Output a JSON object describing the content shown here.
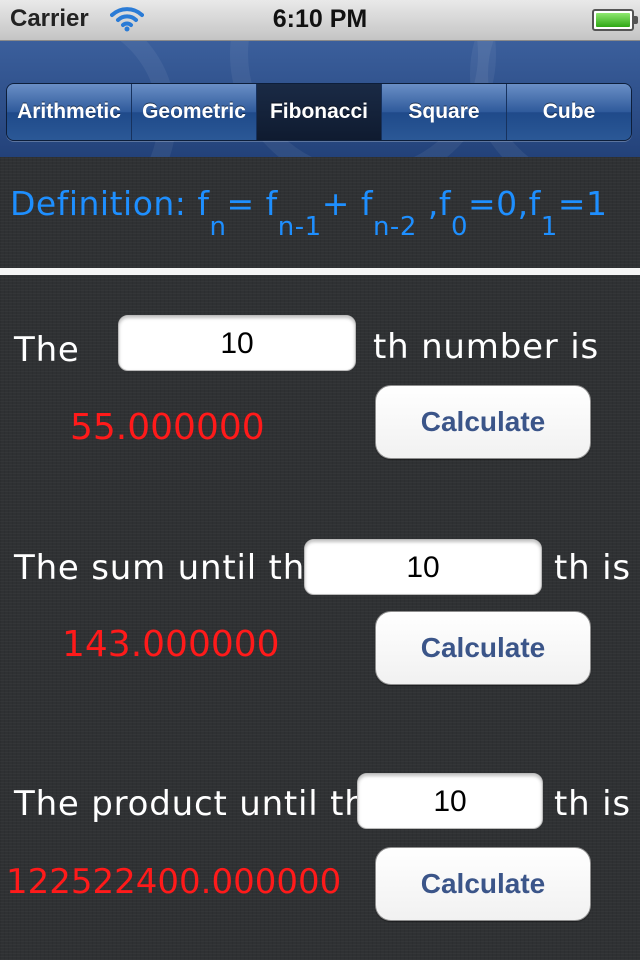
{
  "status_bar": {
    "carrier": "Carrier",
    "time": "6:10 PM"
  },
  "tabs": [
    "Arithmetic",
    "Geometric",
    "Fibonacci",
    "Square",
    "Cube"
  ],
  "selected_tab": "Fibonacci",
  "definition": {
    "prefix": "Definition: f",
    "s1": "n",
    "eq": "= f",
    "s2": "n-1",
    "plus": "+  f",
    "s3": "n-2",
    "comma1": " ,f",
    "s4": "0",
    "mid": "=0,f",
    "s5": "1",
    "end": "=1"
  },
  "section1": {
    "label_before": "The",
    "input_value": "10",
    "label_after": "th number is",
    "result": "55.000000",
    "button": "Calculate"
  },
  "section2": {
    "label_before": "The sum until the",
    "input_value": "10",
    "label_after": "th is",
    "result": "143.000000",
    "button": "Calculate"
  },
  "section3": {
    "label_before": "The product until the",
    "input_value": "10",
    "label_after": "th is",
    "result": "122522400.000000",
    "button": "Calculate"
  },
  "colors": {
    "result": "#ff1a1a",
    "definition": "#1e8fff",
    "button_text": "#3b5589",
    "nav": "#2f5a9b"
  },
  "icons": [
    "wifi-icon",
    "battery-icon"
  ]
}
